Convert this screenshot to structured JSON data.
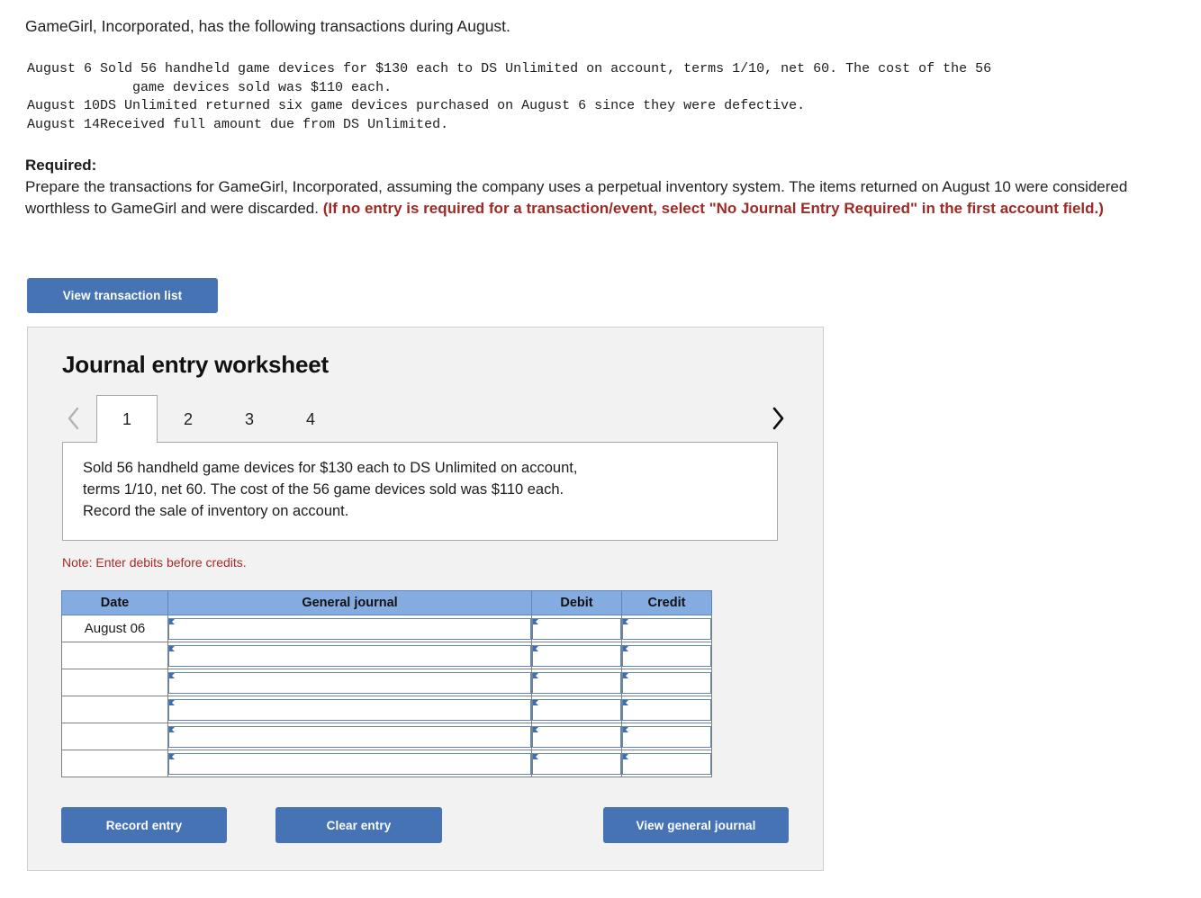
{
  "intro": {
    "text": "GameGirl, Incorporated, has the following transactions during August."
  },
  "transactions": [
    {
      "date": "August 6",
      "description": "Sold 56 handheld game devices for $130 each to DS Unlimited on account, terms 1/10, net 60. The cost of the 56\n    game devices sold was $110 each."
    },
    {
      "date": "August 10",
      "description": "DS Unlimited returned six game devices purchased on August 6 since they were defective."
    },
    {
      "date": "August 14",
      "description": "Received full amount due from DS Unlimited."
    }
  ],
  "required": {
    "label": "Required:",
    "body": "Prepare the transactions for GameGirl, Incorporated, assuming the company uses a perpetual inventory system. The items returned on August 10 were considered worthless to GameGirl and were discarded. ",
    "emphasis": "(If no entry is required for a transaction/event, select \"No Journal Entry Required\" in the first account field.)"
  },
  "toolbar": {
    "view_transaction_list": "View transaction list"
  },
  "worksheet": {
    "title": "Journal entry worksheet",
    "prev_icon": "chevron-left-icon",
    "next_icon": "chevron-right-icon",
    "tabs": [
      {
        "label": "1",
        "active": true
      },
      {
        "label": "2",
        "active": false
      },
      {
        "label": "3",
        "active": false
      },
      {
        "label": "4",
        "active": false
      }
    ],
    "description": [
      "Sold 56 handheld game devices for $130 each to DS Unlimited on account,",
      "terms 1/10, net 60. The cost of the 56 game devices sold was $110 each.",
      "Record the sale of inventory on account."
    ],
    "note": "Note: Enter debits before credits.",
    "table": {
      "headers": [
        "Date",
        "General journal",
        "Debit",
        "Credit"
      ],
      "rows": [
        {
          "date": "August 06",
          "journal": "",
          "debit": "",
          "credit": ""
        },
        {
          "date": "",
          "journal": "",
          "debit": "",
          "credit": ""
        },
        {
          "date": "",
          "journal": "",
          "debit": "",
          "credit": ""
        },
        {
          "date": "",
          "journal": "",
          "debit": "",
          "credit": ""
        },
        {
          "date": "",
          "journal": "",
          "debit": "",
          "credit": ""
        },
        {
          "date": "",
          "journal": "",
          "debit": "",
          "credit": ""
        }
      ]
    },
    "buttons": {
      "record": "Record entry",
      "clear": "Clear entry",
      "view_general_journal": "View general journal"
    }
  },
  "colors": {
    "button_blue": "#4573B4",
    "header_blue": "#85ACE0",
    "panel_gray": "#F2F2F2",
    "emphasis_red": "#9E2A26",
    "note_red": "#A72B2A"
  }
}
